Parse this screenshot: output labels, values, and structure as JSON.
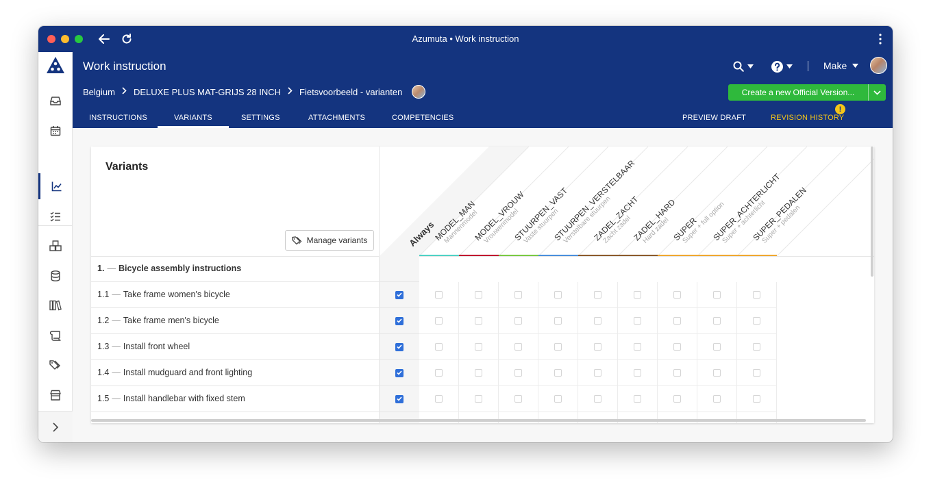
{
  "window": {
    "title": "Azumuta • Work instruction"
  },
  "header": {
    "title": "Work instruction",
    "make_label": "Make",
    "breadcrumb": [
      "Belgium",
      "DELUXE PLUS MAT-GRIJS 28 INCH",
      "Fietsvoorbeeld - varianten"
    ],
    "create_button": "Create a new Official Version...",
    "tabs": [
      "INSTRUCTIONS",
      "VARIANTS",
      "SETTINGS",
      "ATTACHMENTS",
      "COMPETENCIES"
    ],
    "right_tabs": [
      "PREVIEW DRAFT",
      "REVISION HISTORY"
    ],
    "revision_badge": "!"
  },
  "colors": {
    "brand": "#14347f",
    "primary_action": "#2fb93c",
    "checked": "#2f6fd9",
    "warning": "#f5c518"
  },
  "variants_card": {
    "title": "Variants",
    "manage_button": "Manage variants",
    "always_label": "Always",
    "variants": [
      {
        "name": "MODEL_MAN",
        "desc": "Mannenmodel",
        "color": "#4fd1c5"
      },
      {
        "name": "MODEL_VROUW",
        "desc": "Vrouwenmodel",
        "color": "#c0152f"
      },
      {
        "name": "STUURPEN_VAST",
        "desc": "Vaste stuurpen",
        "color": "#7ac943"
      },
      {
        "name": "STUURPEN_VERSTELBAAR",
        "desc": "Verstelbare stuurpen",
        "color": "#4a8fdc"
      },
      {
        "name": "ZADEL_ZACHT",
        "desc": "Zacht zadel",
        "color": "#8b5a2b"
      },
      {
        "name": "ZADEL_HARD",
        "desc": "Hard zadel",
        "color": "#8b5a2b"
      },
      {
        "name": "SUPER",
        "desc": "Super + full option",
        "color": "#f0a830"
      },
      {
        "name": "SUPER_ACHTERLICHT",
        "desc": "Super + achterlicht",
        "color": "#f0a830"
      },
      {
        "name": "SUPER_PEDALEN",
        "desc": "Super + pedalen",
        "color": "#f0a830"
      }
    ],
    "section": {
      "number": "1.",
      "label": "Bicycle assembly instructions"
    },
    "rows": [
      {
        "number": "1.1",
        "label": "Take frame women's bicycle",
        "always": true
      },
      {
        "number": "1.2",
        "label": "Take frame men's bicycle",
        "always": true
      },
      {
        "number": "1.3",
        "label": "Install front wheel",
        "always": true
      },
      {
        "number": "1.4",
        "label": "Install mudguard and front lighting",
        "always": true
      },
      {
        "number": "1.5",
        "label": "Install handlebar with fixed stem",
        "always": true
      }
    ]
  }
}
